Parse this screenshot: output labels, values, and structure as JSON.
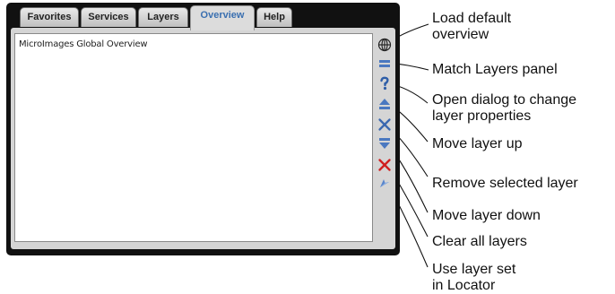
{
  "tabs": [
    {
      "label": "Favorites"
    },
    {
      "label": "Services"
    },
    {
      "label": "Layers"
    },
    {
      "label": "Overview"
    },
    {
      "label": "Help"
    }
  ],
  "active_tab": "Overview",
  "list": {
    "items": [
      {
        "label": "MicroImages Global Overview"
      }
    ]
  },
  "toolbar_icons": [
    {
      "name": "globe-icon"
    },
    {
      "name": "match-layers-icon"
    },
    {
      "name": "question-icon"
    },
    {
      "name": "move-up-icon"
    },
    {
      "name": "remove-layer-icon"
    },
    {
      "name": "move-down-icon"
    },
    {
      "name": "clear-all-icon"
    },
    {
      "name": "use-layer-set-icon"
    }
  ],
  "callouts": {
    "load_default": [
      "Load default",
      "overview"
    ],
    "match_layers": [
      "Match Layers panel"
    ],
    "open_dialog": [
      "Open dialog to change",
      "layer properties"
    ],
    "move_up": [
      "Move layer up"
    ],
    "remove_selected": [
      "Remove selected layer"
    ],
    "move_down": [
      "Move layer down"
    ],
    "clear_all": [
      "Clear all layers"
    ],
    "use_layer_set": [
      "Use layer set",
      "in Locator"
    ]
  },
  "colors": {
    "active_tab_text": "#3a6fb0",
    "icon_blue": "#4a78c0",
    "icon_red": "#d02020",
    "panel_frame": "#111111"
  }
}
